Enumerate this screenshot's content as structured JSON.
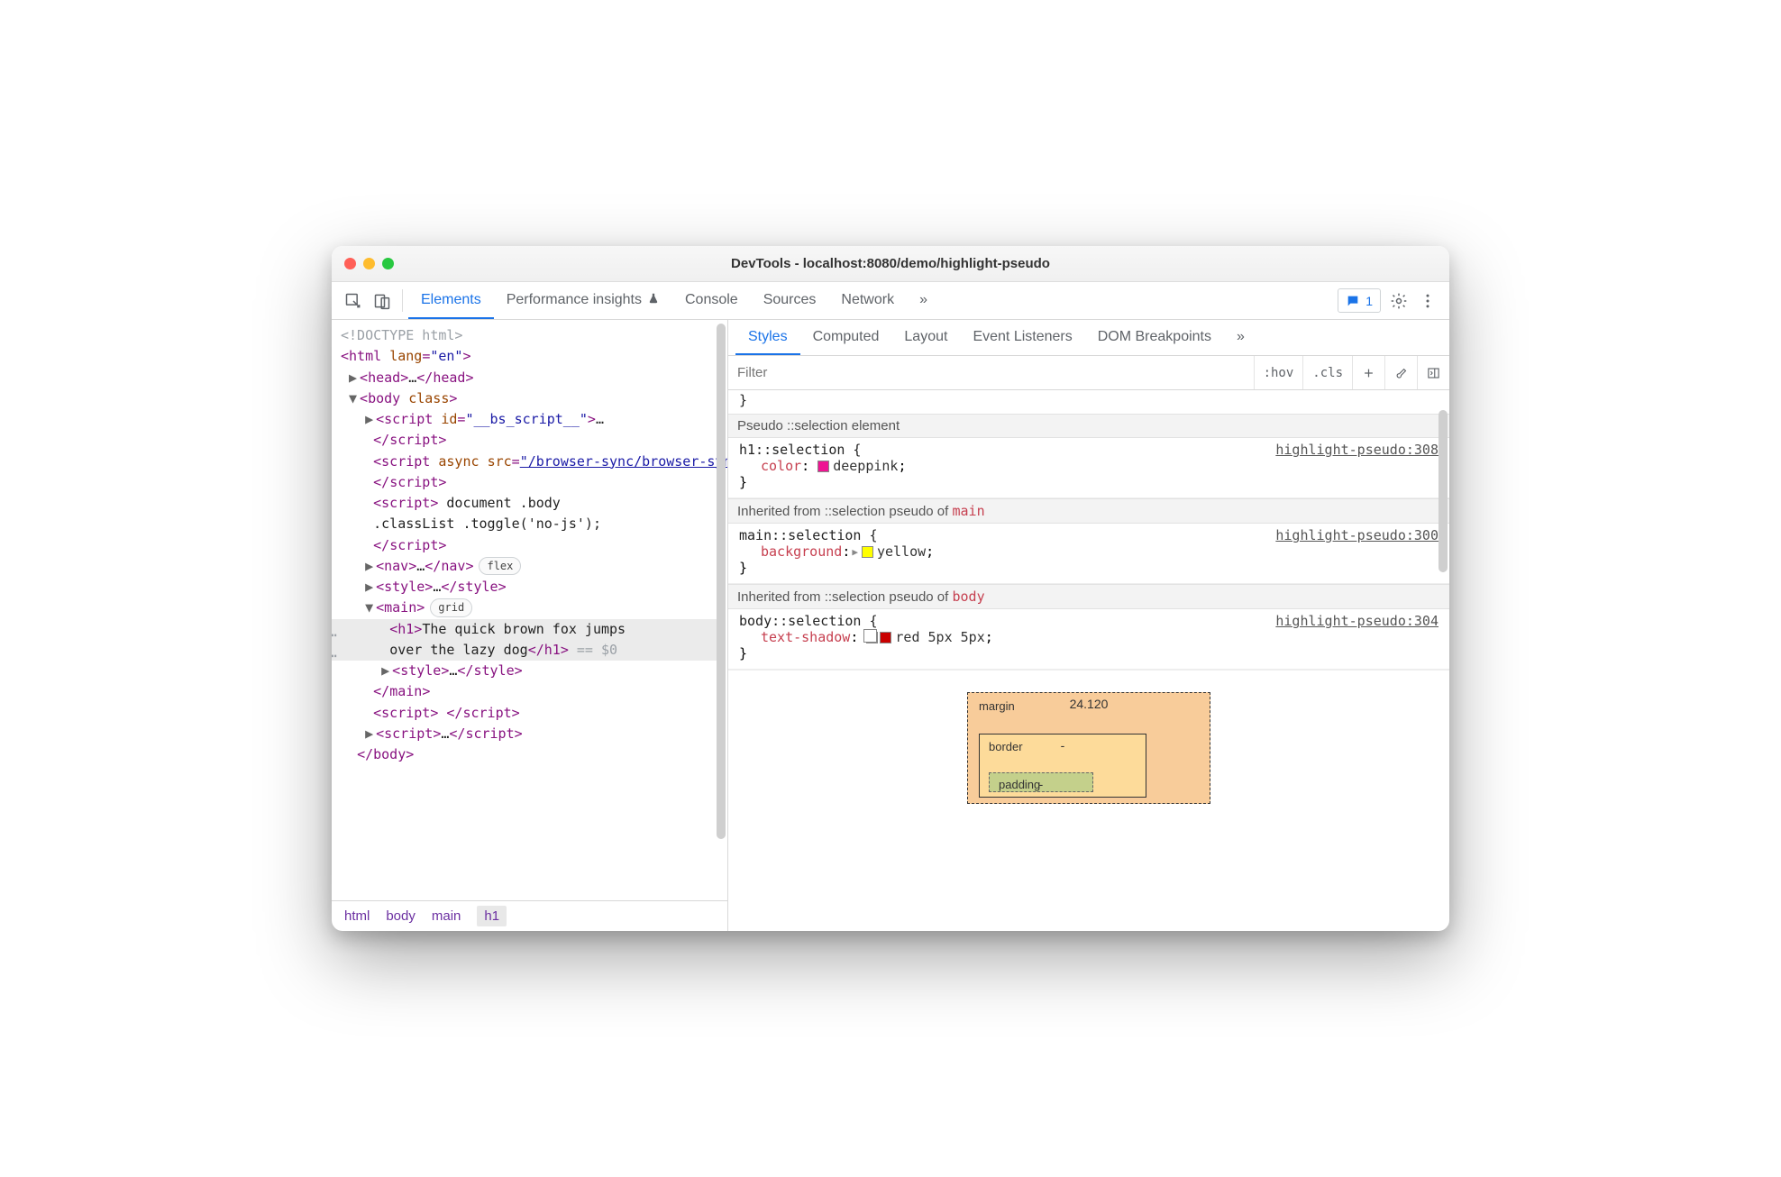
{
  "titlebar": {
    "title": "DevTools - localhost:8080/demo/highlight-pseudo"
  },
  "toolbar": {
    "tabs": [
      {
        "label": "Elements",
        "active": true
      },
      {
        "label": "Performance insights",
        "beaker": true
      },
      {
        "label": "Console"
      },
      {
        "label": "Sources"
      },
      {
        "label": "Network"
      }
    ],
    "issues_count": "1"
  },
  "dom": {
    "doctype": "<!DOCTYPE html>",
    "html_open": {
      "tag": "html",
      "attr": "lang",
      "val": "\"en\""
    },
    "head": "head",
    "body_open": {
      "tag": "body",
      "attr": "class"
    },
    "script1": {
      "tag": "script",
      "attr": "id",
      "val": "\"__bs_script__\""
    },
    "script2_open": {
      "tag": "script",
      "attr1": "async",
      "attr2": "src"
    },
    "script2_href": "\"/browser-sync/browser-sync-client.js?v=2.26.7\"",
    "script3_text1": " document .body",
    "script3_text2": ".classList .toggle('no-js');",
    "nav_badge": "flex",
    "main_badge": "grid",
    "h1_text1": "The quick brown fox jumps",
    "h1_text2": "over the lazy dog",
    "eqdollar": " == $0"
  },
  "crumbs": [
    "html",
    "body",
    "main",
    "h1"
  ],
  "styles": {
    "tabs": [
      "Styles",
      "Computed",
      "Layout",
      "Event Listeners",
      "DOM Breakpoints"
    ],
    "filter_placeholder": "Filter",
    "hov": ":hov",
    "cls": ".cls",
    "head1": "Pseudo ::selection element",
    "rule1": {
      "selector": "h1::selection {",
      "prop": "color",
      "val": "deeppink",
      "swatch": "#ee1492",
      "src": "highlight-pseudo:308"
    },
    "head2_a": "Inherited from ::selection pseudo of ",
    "head2_b": "main",
    "rule2": {
      "selector": "main::selection {",
      "prop": "background",
      "val": "yellow",
      "swatch": "#ffff00",
      "src": "highlight-pseudo:300"
    },
    "head3_a": "Inherited from ::selection pseudo of ",
    "head3_b": "body",
    "rule3": {
      "selector": "body::selection {",
      "prop": "text-shadow",
      "val": "red 5px 5px",
      "swatch": "#c90000",
      "src": "highlight-pseudo:304"
    },
    "box": {
      "margin_label": "margin",
      "margin_top": "24.120",
      "border_label": "border",
      "border_top": "-",
      "padding_label": "padding",
      "padding_top": "-"
    }
  }
}
